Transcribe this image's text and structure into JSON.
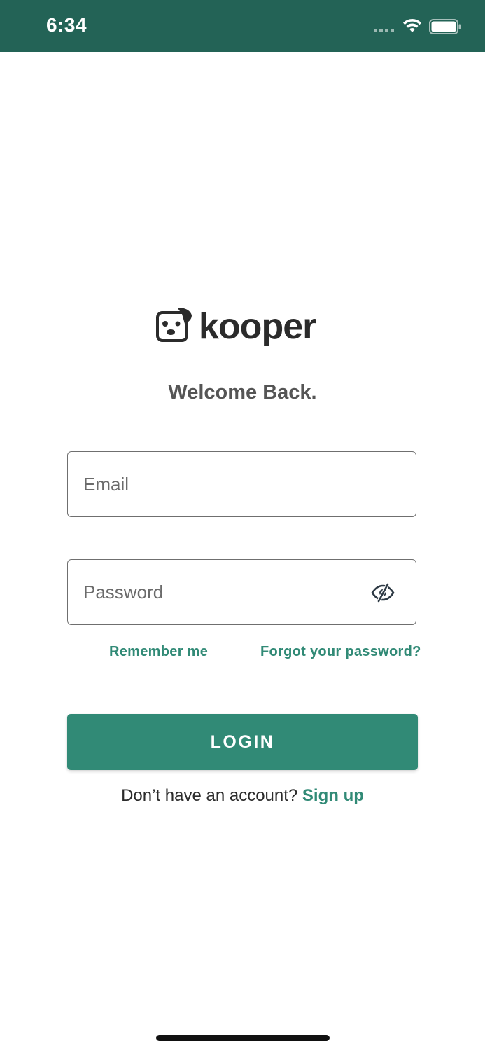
{
  "status_bar": {
    "time": "6:34",
    "background": "#236356",
    "icons": [
      "signal-icon",
      "wifi-icon",
      "battery-icon"
    ]
  },
  "logo": {
    "wordmark": "kooper",
    "icon": "dog-face-logo-icon"
  },
  "welcome": "Welcome Back.",
  "form": {
    "email_placeholder": "Email",
    "email_value": "",
    "password_placeholder": "Password",
    "password_value": "",
    "password_toggle_icon": "eye-slash-icon",
    "remember_label": "Remember me",
    "forgot_label": "Forgot your password?"
  },
  "login_label": "LOGIN",
  "signup": {
    "prompt": "Don’t have an account?",
    "link": "Sign up"
  },
  "colors": {
    "primary": "#318a76",
    "status_bar": "#236356",
    "heading": "#555555",
    "text": "#2b2b2b"
  }
}
